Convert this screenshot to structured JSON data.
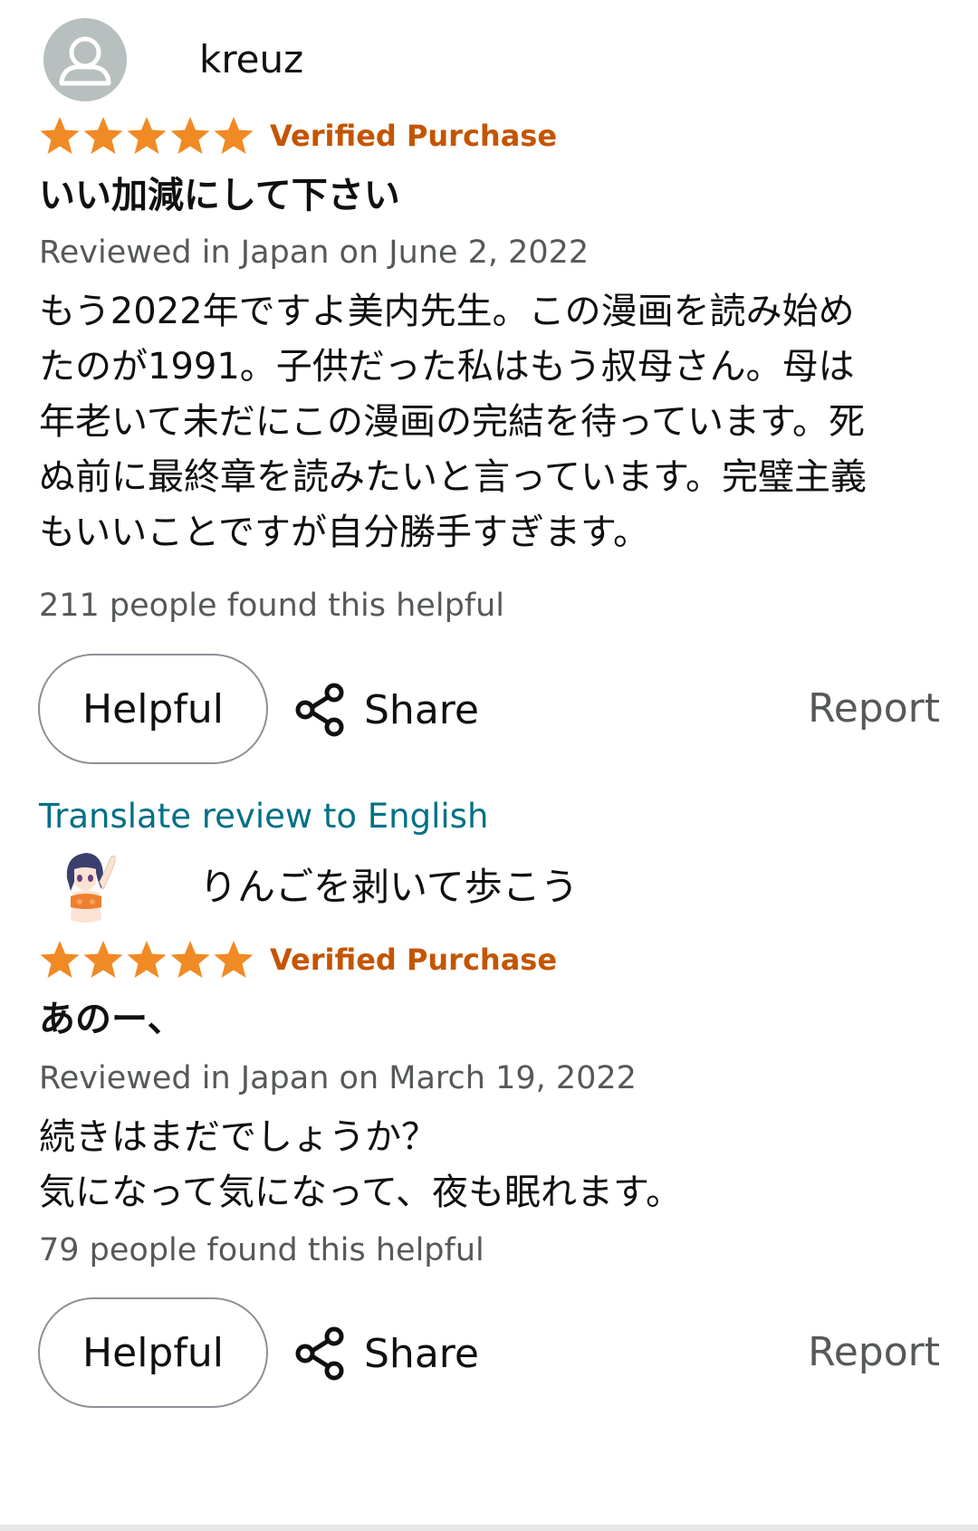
{
  "colors": {
    "star": "#f08a24",
    "verified": "#c45500",
    "link": "#007185",
    "muted": "#565959"
  },
  "reviews": [
    {
      "username": "kreuz",
      "avatar": "default-user-icon",
      "rating": 5,
      "verified": "Verified Purchase",
      "title": "いい加減にして下さい",
      "date": "Reviewed in Japan on June 2, 2022",
      "body_lines": [
        "もう2022年ですよ美内先生。この漫画を読み始め",
        "たのが1991。子供だった私はもう叔母さん。母は",
        "年老いて未だにこの漫画の完結を待っています。死",
        "ぬ前に最終章を読みたいと言っています。完璧主義",
        "もいいことですが自分勝手すぎます。"
      ],
      "helpful_count": "211 people found this helpful",
      "helpful_button": "Helpful",
      "share_label": "Share",
      "report_label": "Report",
      "translate_label": "Translate review to English"
    },
    {
      "username": "りんごを剥いて歩こう",
      "avatar": "anime-character-avatar",
      "rating": 5,
      "verified": "Verified Purchase",
      "title": "あのー、",
      "date": "Reviewed in Japan on March 19, 2022",
      "body_lines": [
        "続きはまだでしょうか？",
        "気になって気になって、夜も眠れます。"
      ],
      "helpful_count": "79 people found this helpful",
      "helpful_button": "Helpful",
      "share_label": "Share",
      "report_label": "Report"
    }
  ]
}
